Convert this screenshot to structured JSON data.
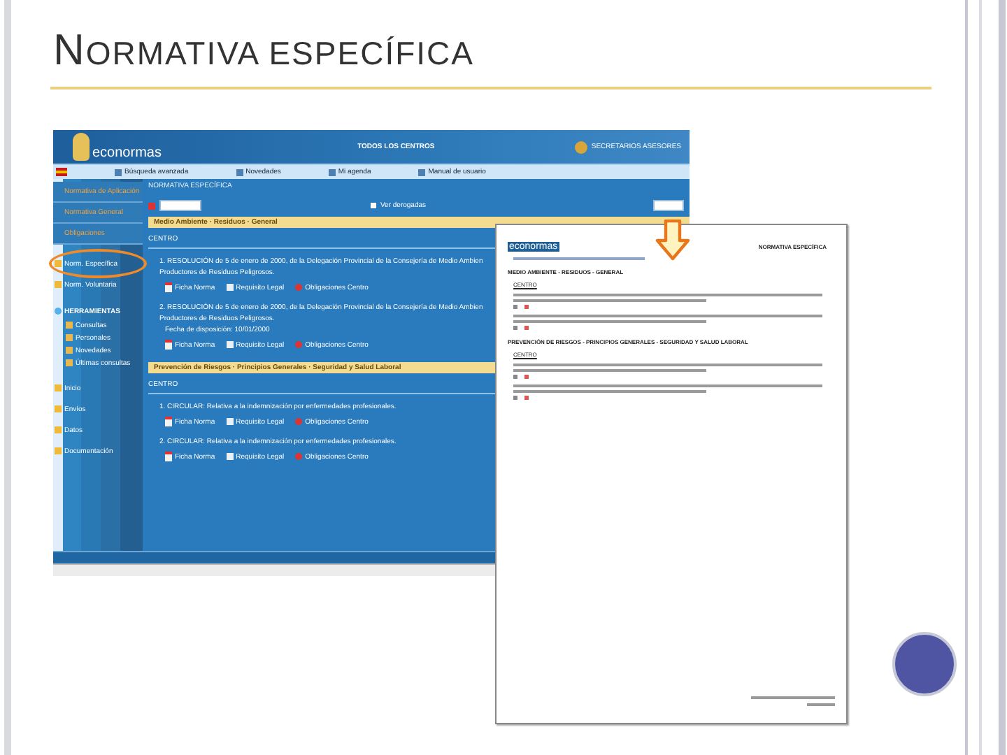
{
  "slide": {
    "title": "NORMATIVA ESPECÍFICA"
  },
  "app": {
    "logo": "econormas",
    "center_title": "TODOS LOS CENTROS",
    "user": "SECRETARIOS ASESORES",
    "menu": [
      {
        "label": "Búsqueda avanzada"
      },
      {
        "label": "Novedades"
      },
      {
        "label": "Mi agenda"
      },
      {
        "label": "Manual de usuario"
      }
    ],
    "sidebar": [
      {
        "kind": "link",
        "label": "Normativa de Aplicación",
        "circled": false
      },
      {
        "kind": "link",
        "label": "Normativa General",
        "circled": false
      },
      {
        "kind": "link",
        "label": "Obligaciones",
        "circled": false
      },
      {
        "kind": "item",
        "label": "Norm. Específica",
        "circled": true
      },
      {
        "kind": "item",
        "label": "Norm. Voluntaria",
        "circled": false
      },
      {
        "kind": "heading",
        "label": "HERRAMIENTAS",
        "circled": false
      },
      {
        "kind": "tool",
        "label": "Consultas",
        "circled": false
      },
      {
        "kind": "tool",
        "label": "Personales",
        "circled": false
      },
      {
        "kind": "tool",
        "label": "Novedades",
        "circled": false
      },
      {
        "kind": "tool",
        "label": "Últimas consultas",
        "circled": false
      },
      {
        "kind": "item",
        "label": "Inicio",
        "circled": false
      },
      {
        "kind": "item",
        "label": "Envíos",
        "circled": false
      },
      {
        "kind": "item",
        "label": "Datos",
        "circled": false
      },
      {
        "kind": "item",
        "label": "Documentación",
        "circled": false
      }
    ],
    "page_title": "NORMATIVA ESPECÍFICA",
    "filter": {
      "label": "Ver derogadas",
      "checked": false
    },
    "sections": [
      {
        "heading": "Medio Ambiente · Residuos · General",
        "group": "CENTRO",
        "items": [
          {
            "title": "1. RESOLUCIÓN de 5 de enero de 2000, de la Delegación Provincial de la Consejería de Medio Ambien",
            "subtitle": "Productores de Residuos Peligrosos.",
            "links": [
              "Ficha Norma",
              "Requisito Legal",
              "Obligaciones Centro"
            ]
          },
          {
            "title": "2. RESOLUCIÓN de 5 de enero de 2000, de la Delegación Provincial de la Consejería de Medio Ambien",
            "subtitle": "Productores de Residuos Peligrosos.",
            "date": "Fecha de disposición: 10/01/2000",
            "links": [
              "Ficha Norma",
              "Requisito Legal",
              "Obligaciones Centro"
            ]
          }
        ]
      },
      {
        "heading": "Prevención de Riesgos · Principios Generales · Seguridad y Salud Laboral",
        "group": "CENTRO",
        "items": [
          {
            "title": "1. CIRCULAR: Relativa a la indemnización por enfermedades profesionales.",
            "links": [
              "Ficha Norma",
              "Requisito Legal",
              "Obligaciones Centro"
            ]
          },
          {
            "title": "2. CIRCULAR: Relativa a la indemnización por enfermedades profesionales.",
            "links": [
              "Ficha Norma",
              "Requisito Legal",
              "Obligaciones Centro"
            ]
          }
        ]
      }
    ]
  },
  "document": {
    "logo": "econormas",
    "title": "NORMATIVA ESPECÍFICA",
    "sections": [
      {
        "heading": "MEDIO AMBIENTE - RESIDUOS - GENERAL",
        "group": "CENTRO",
        "items": [
          {
            "kind": "blurred"
          },
          {
            "kind": "blurred"
          }
        ]
      },
      {
        "heading": "PREVENCIÓN DE RIESGOS - PRINCIPIOS GENERALES - SEGURIDAD Y SALUD LABORAL",
        "group": "CENTRO",
        "items": [
          {
            "kind": "blurred"
          },
          {
            "kind": "blurred"
          }
        ]
      }
    ]
  }
}
